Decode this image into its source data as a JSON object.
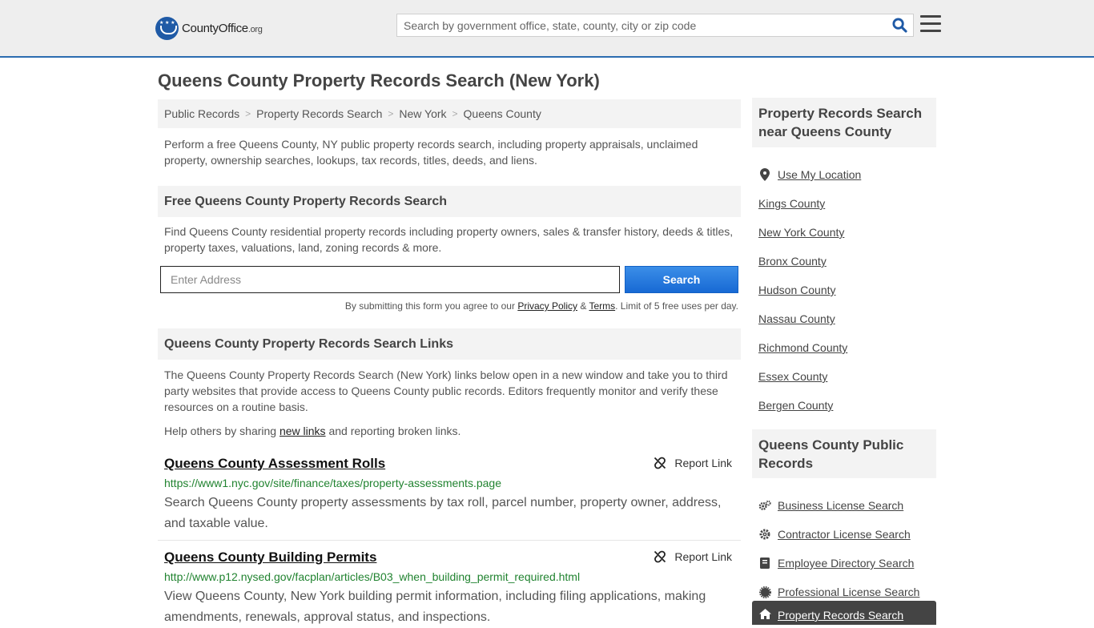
{
  "header": {
    "logo_text_main": "County",
    "logo_text_bold": "Office",
    "logo_text_tld": ".org",
    "search_placeholder": "Search by government office, state, county, city or zip code",
    "search_icon": "search-icon",
    "menu_icon": "hamburger-menu-icon",
    "accent_color": "#2b6cb0"
  },
  "page": {
    "title": "Queens County Property Records Search (New York)",
    "breadcrumb": [
      "Public Records",
      "Property Records Search",
      "New York",
      "Queens County"
    ],
    "intro": "Perform a free Queens County, NY public property records search, including property appraisals, unclaimed property, ownership searches, lookups, tax records, titles, deeds, and liens."
  },
  "search_section": {
    "heading": "Free Queens County Property Records Search",
    "description": "Find Queens County residential property records including property owners, sales & transfer history, deeds & titles, property taxes, valuations, land, zoning records & more.",
    "address_placeholder": "Enter Address",
    "button_label": "Search",
    "button_color": "#1769d4",
    "disclaimer_pre": "By submitting this form you agree to our ",
    "privacy_label": "Privacy Policy",
    "amp": " & ",
    "terms_label": "Terms",
    "disclaimer_post": ". Limit of 5 free uses per day."
  },
  "links_section": {
    "heading": "Queens County Property Records Search Links",
    "description": "The Queens County Property Records Search (New York) links below open in a new window and take you to third party websites that provide access to Queens County public records. Editors frequently monitor and verify these resources on a routine basis.",
    "help_pre": "Help others by sharing ",
    "help_link": "new links",
    "help_post": " and reporting broken links.",
    "report_label": "Report Link",
    "url_color": "#218330",
    "entries": [
      {
        "title": "Queens County Assessment Rolls",
        "url": "https://www1.nyc.gov/site/finance/taxes/property-assessments.page",
        "description": "Search Queens County property assessments by tax roll, parcel number, property owner, address, and taxable value."
      },
      {
        "title": "Queens County Building Permits",
        "url": "http://www.p12.nysed.gov/facplan/articles/B03_when_building_permit_required.html",
        "description": "View Queens County, New York building permit information, including filing applications, making amendments, renewals, approval status, and inspections."
      }
    ]
  },
  "sidebar": {
    "nearby_heading": "Property Records Search near Queens County",
    "use_location": "Use My Location",
    "nearby": [
      "Kings County",
      "New York County",
      "Bronx County",
      "Hudson County",
      "Nassau County",
      "Richmond County",
      "Essex County",
      "Bergen County"
    ],
    "public_records_heading": "Queens County Public Records",
    "public_records": [
      {
        "label": "Business License Search",
        "icon": "gears-icon"
      },
      {
        "label": "Contractor License Search",
        "icon": "gear-icon"
      },
      {
        "label": "Employee Directory Search",
        "icon": "book-icon"
      },
      {
        "label": "Professional License Search",
        "icon": "certificate-icon"
      }
    ],
    "active_item": {
      "label": "Property Records Search",
      "icon": "home-icon"
    }
  }
}
